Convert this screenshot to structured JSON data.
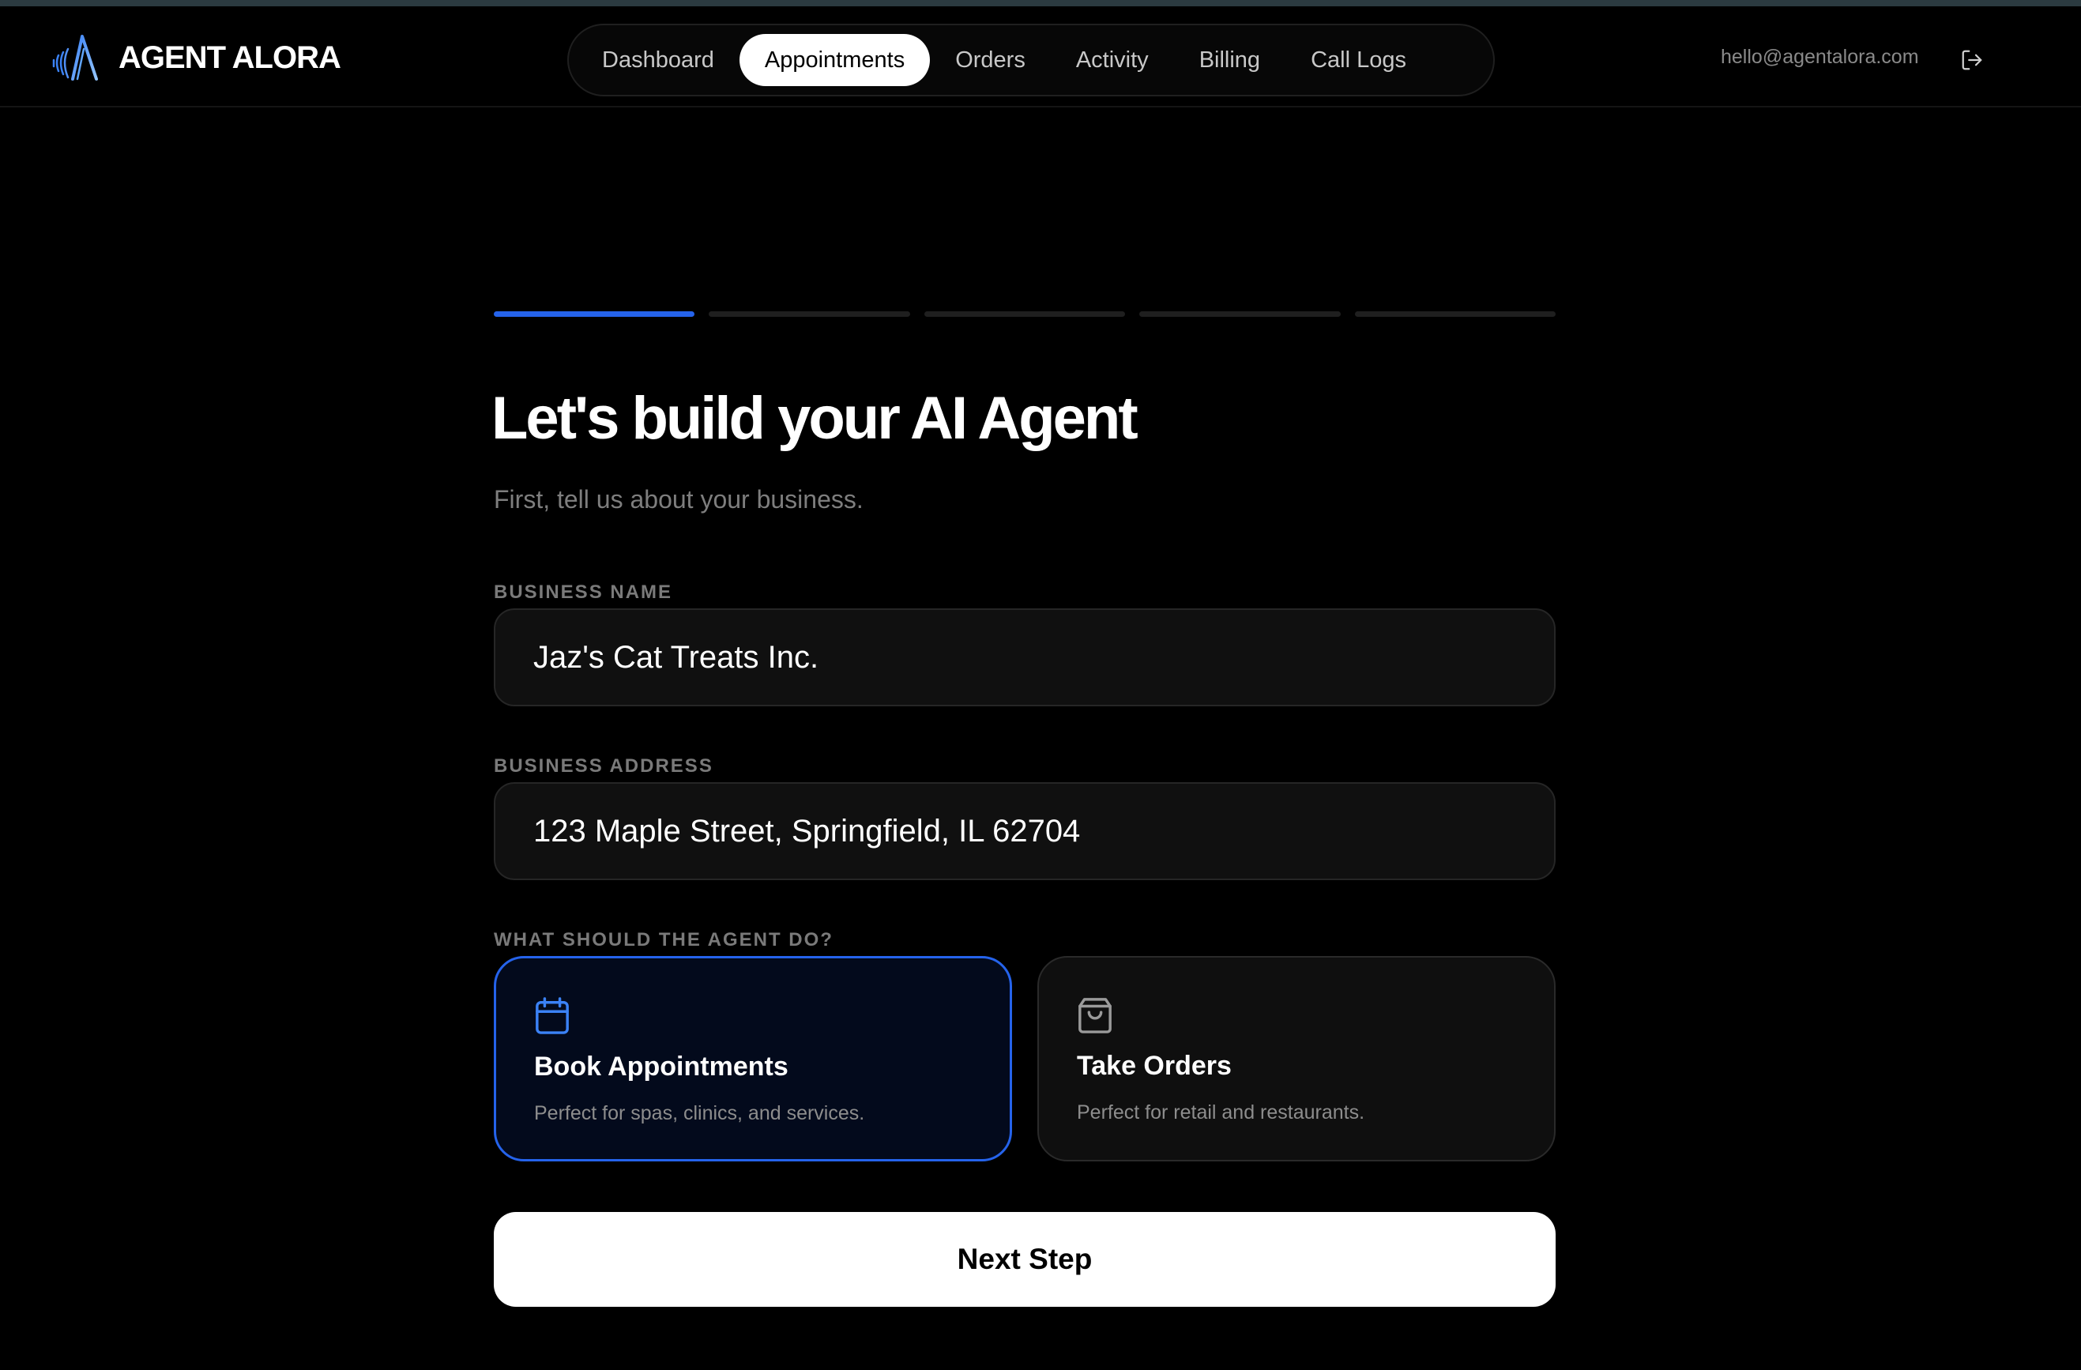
{
  "app": {
    "brand_name": "AGENT ALORA",
    "logo_icon": "sound-wave-a-logo-icon"
  },
  "nav": {
    "items": [
      {
        "label": "Dashboard",
        "active": false
      },
      {
        "label": "Appointments",
        "active": true
      },
      {
        "label": "Orders",
        "active": false
      },
      {
        "label": "Activity",
        "active": false
      },
      {
        "label": "Billing",
        "active": false
      },
      {
        "label": "Call Logs",
        "active": false
      }
    ]
  },
  "user": {
    "email": "hello@agentalora.com",
    "logout_icon": "logout-icon"
  },
  "wizard": {
    "current_step": 1,
    "total_steps": 5,
    "title": "Let's build your AI Agent",
    "subtitle": "First, tell us about your business.",
    "business_name": {
      "label": "BUSINESS NAME",
      "value": "Jaz's Cat Treats Inc."
    },
    "business_address": {
      "label": "BUSINESS ADDRESS",
      "value": "123 Maple Street, Springfield, IL 62704"
    },
    "agent_task": {
      "label": "WHAT SHOULD THE AGENT DO?",
      "options": [
        {
          "icon": "calendar-icon",
          "title": "Book Appointments",
          "description": "Perfect for spas, clinics, and services.",
          "selected": true
        },
        {
          "icon": "shopping-bag-icon",
          "title": "Take Orders",
          "description": "Perfect for retail and restaurants.",
          "selected": false
        }
      ]
    },
    "next_label": "Next Step"
  },
  "colors": {
    "accent": "#2563eb",
    "background": "#000000",
    "field_bg": "#101010"
  }
}
